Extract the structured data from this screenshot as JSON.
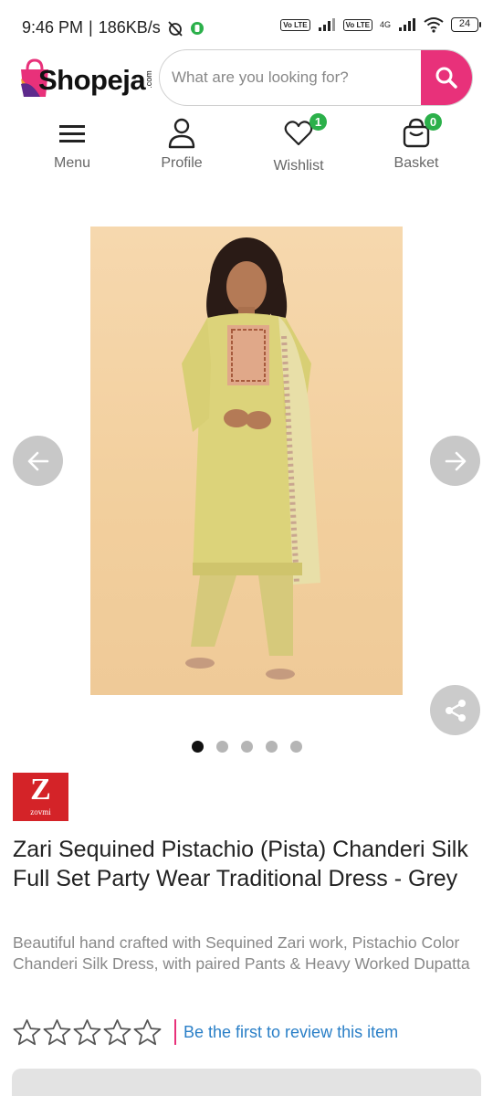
{
  "status_bar": {
    "time": "9:46 PM",
    "separator": "|",
    "speed": "186KB/s",
    "network_label": "4G",
    "volte_label_1": "Vo LTE",
    "volte_label_2": "Vo LTE",
    "battery": "24"
  },
  "header": {
    "logo_text": "Shopeja",
    "logo_suffix": ".com",
    "search_placeholder": "What are you looking for?"
  },
  "nav": {
    "items": [
      {
        "label": "Menu",
        "icon": "hamburger-icon"
      },
      {
        "label": "Profile",
        "icon": "user-icon"
      },
      {
        "label": "Wishlist",
        "icon": "heart-icon",
        "badge": "1"
      },
      {
        "label": "Basket",
        "icon": "basket-icon",
        "badge": "0"
      }
    ]
  },
  "carousel": {
    "slide_count": 5,
    "active_slide": 1
  },
  "product": {
    "brand_letter": "Z",
    "brand_name": "zovmi",
    "title": "Zari Sequined Pistachio (Pista) Chanderi Silk Full Set Party Wear Traditional Dress - Grey",
    "description": "Beautiful hand crafted with Sequined Zari work, Pistachio Color Chanderi Silk Dress, with paired Pants & Heavy Worked Dupatta",
    "rating": 0,
    "max_rating": 5,
    "review_link": "Be the first to review this item"
  },
  "colors": {
    "accent": "#e8317a",
    "badge": "#2bb04a",
    "link": "#2a7fc7",
    "brand_red": "#d42328"
  }
}
